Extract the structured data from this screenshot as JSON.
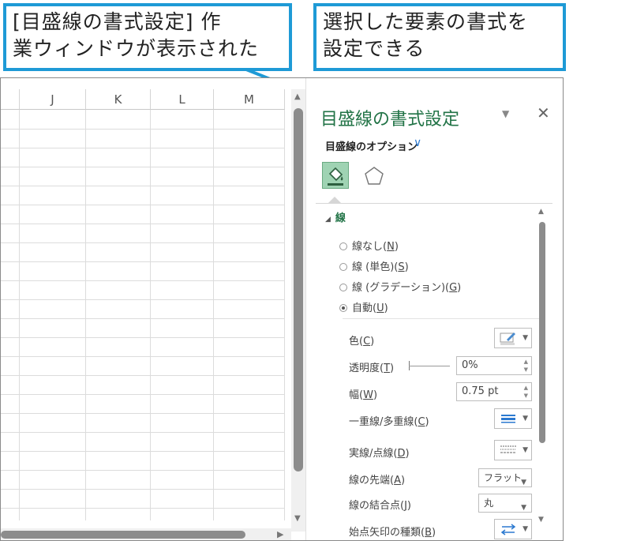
{
  "callouts": {
    "left_line1": "[目盛線の書式設定] 作",
    "left_line2": "業ウィンドウが表示された",
    "right_line1": "選択した要素の書式を",
    "right_line2": "設定できる"
  },
  "accent_color": "#1e9ad6",
  "excel_green": "#217346",
  "sheet": {
    "columns": [
      "J",
      "K",
      "L",
      "M"
    ]
  },
  "pane": {
    "title": "目盛線の書式設定",
    "dropdown_icon": "▼",
    "close_icon": "✕",
    "options_label": "目盛線のオプション",
    "options_chevron": "∨",
    "tabs": [
      {
        "icon": "fill-line-icon",
        "active": true
      },
      {
        "icon": "effects-pentagon-icon",
        "active": false
      }
    ],
    "section": {
      "toggle": "◢",
      "label": "線"
    },
    "radios": [
      {
        "label": "線なし(",
        "key": "N",
        "suffix": ")",
        "selected": false
      },
      {
        "label": "線 (単色)(",
        "key": "S",
        "suffix": ")",
        "selected": false
      },
      {
        "label": "線 (グラデーション)(",
        "key": "G",
        "suffix": ")",
        "selected": false
      },
      {
        "label": "自動(",
        "key": "U",
        "suffix": ")",
        "selected": true
      }
    ],
    "color": {
      "label": "色(",
      "key": "C",
      "suffix": ")"
    },
    "transparency": {
      "label": "透明度(",
      "key": "T",
      "suffix": ")",
      "value": "0%"
    },
    "width": {
      "label": "幅(",
      "key": "W",
      "suffix": ")",
      "value": "0.75 pt"
    },
    "compound": {
      "label": "一重線/多重線(",
      "key": "C",
      "suffix": ")"
    },
    "dash": {
      "label": "実線/点線(",
      "key": "D",
      "suffix": ")"
    },
    "cap": {
      "label": "線の先端(",
      "key": "A",
      "suffix": ")",
      "value": "フラット"
    },
    "join": {
      "label": "線の結合点(",
      "key": "J",
      "suffix": ")",
      "value": "丸"
    },
    "arrow": {
      "label": "始点矢印の種類(",
      "key": "B",
      "suffix": ")"
    }
  }
}
